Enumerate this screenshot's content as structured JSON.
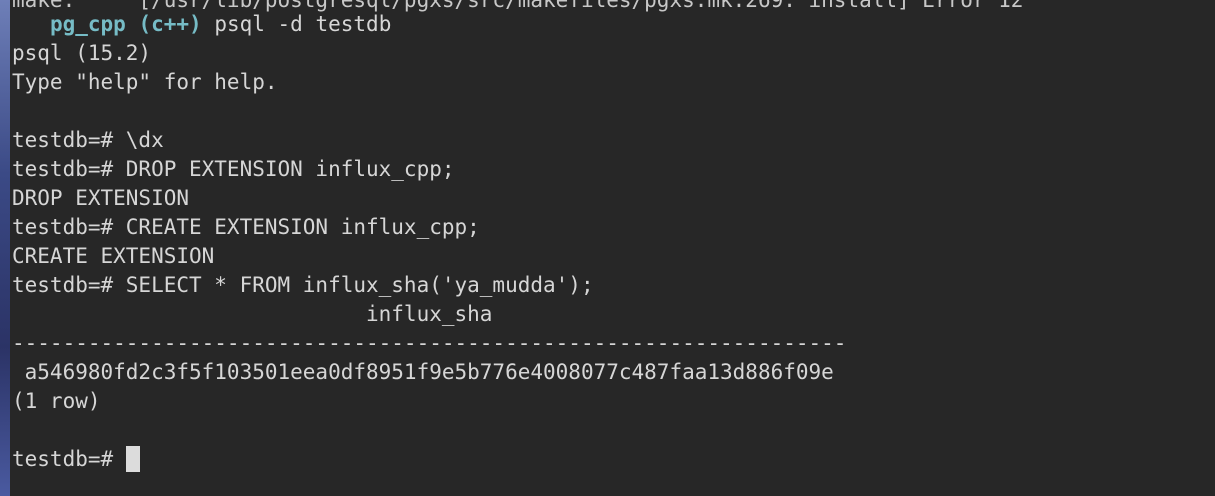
{
  "terminal": {
    "clipped_top_line": "make:     [/usr/lib/postgresql/pgxs/src/makefiles/pgxs.mk:269: install] Error 12",
    "prompt_line": {
      "env_name": "pg_cpp",
      "env_lang": "(c++)",
      "command": "psql -d testdb"
    },
    "lines": [
      "psql (15.2)",
      "Type \"help\" for help.",
      "",
      "testdb=# \\dx",
      "testdb=# DROP EXTENSION influx_cpp;",
      "DROP EXTENSION",
      "testdb=# CREATE EXTENSION influx_cpp;",
      "CREATE EXTENSION",
      "testdb=# SELECT * FROM influx_sha('ya_mudda');",
      "                            influx_sha",
      "------------------------------------------------------------------",
      " a546980fd2c3f5f103501eea0df8951f9e5b776e4008077c487faa13d886f09e",
      "(1 row)",
      ""
    ],
    "current_prompt": "testdb=# "
  }
}
